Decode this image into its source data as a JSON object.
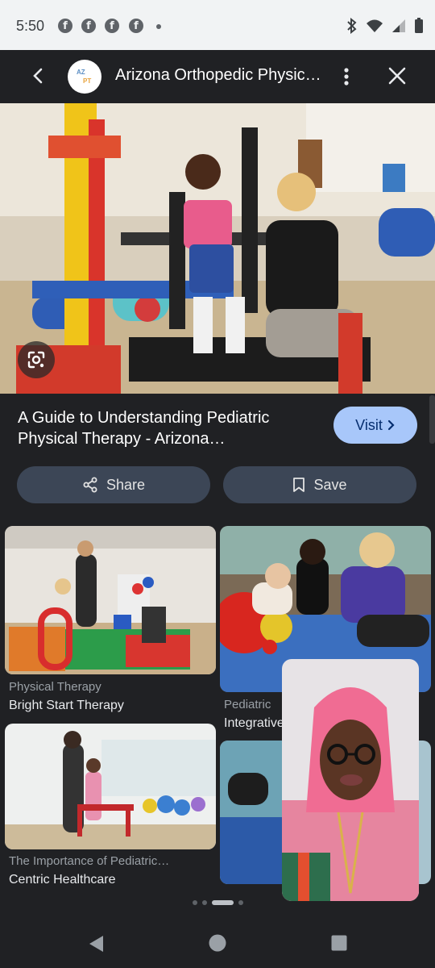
{
  "status_bar": {
    "time": "5:50",
    "notification_icons": [
      "facebook-icon",
      "facebook-icon",
      "facebook-icon",
      "facebook-icon",
      "dot-icon"
    ],
    "right_icons": [
      "bluetooth-icon",
      "wifi-icon",
      "signal-icon",
      "battery-icon"
    ]
  },
  "header": {
    "logo_text_top": "AZ",
    "logo_text_bottom": "PT",
    "title": "Arizona Orthopedic Physic…"
  },
  "result": {
    "caption": "A Guide to Understanding Pediatric Physical Therapy - Arizona…",
    "visit_label": "Visit",
    "share_label": "Share",
    "save_label": "Save"
  },
  "related": [
    {
      "source": "Physical Therapy",
      "title": "Bright Start Therapy"
    },
    {
      "source": "Pediatric",
      "title": "Integrative"
    },
    {
      "source": "The Importance of Pediatric…",
      "title": "Centric Healthcare"
    }
  ],
  "colors": {
    "accent": "#a8c7fa",
    "pill_bg": "#3c4656",
    "background": "#202124"
  }
}
